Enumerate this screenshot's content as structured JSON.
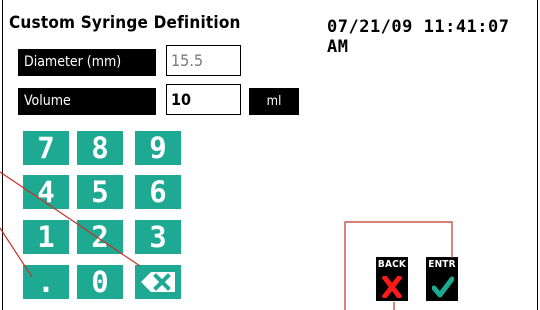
{
  "screen": {
    "title": "Custom Syringe Definition",
    "datetime": "07/21/09 11:41:07 AM"
  },
  "fields": {
    "diameter": {
      "label": "Diameter (mm)",
      "value": "15.5"
    },
    "volume": {
      "label": "Volume",
      "value": "10",
      "unit": "ml"
    }
  },
  "keypad": {
    "keys": [
      "7",
      "8",
      "9",
      "4",
      "5",
      "6",
      "1",
      "2",
      "3",
      ".",
      "0"
    ],
    "backspace_icon": "backspace-icon",
    "key_color": "#1eaa92"
  },
  "actions": {
    "back_label": "BACK",
    "enter_label": "ENTR",
    "back_icon": "red-x-icon",
    "enter_icon": "green-check-icon",
    "back_color": "#ff1a1a",
    "enter_color": "#1eaa92"
  },
  "annotation_color": "#c83228"
}
